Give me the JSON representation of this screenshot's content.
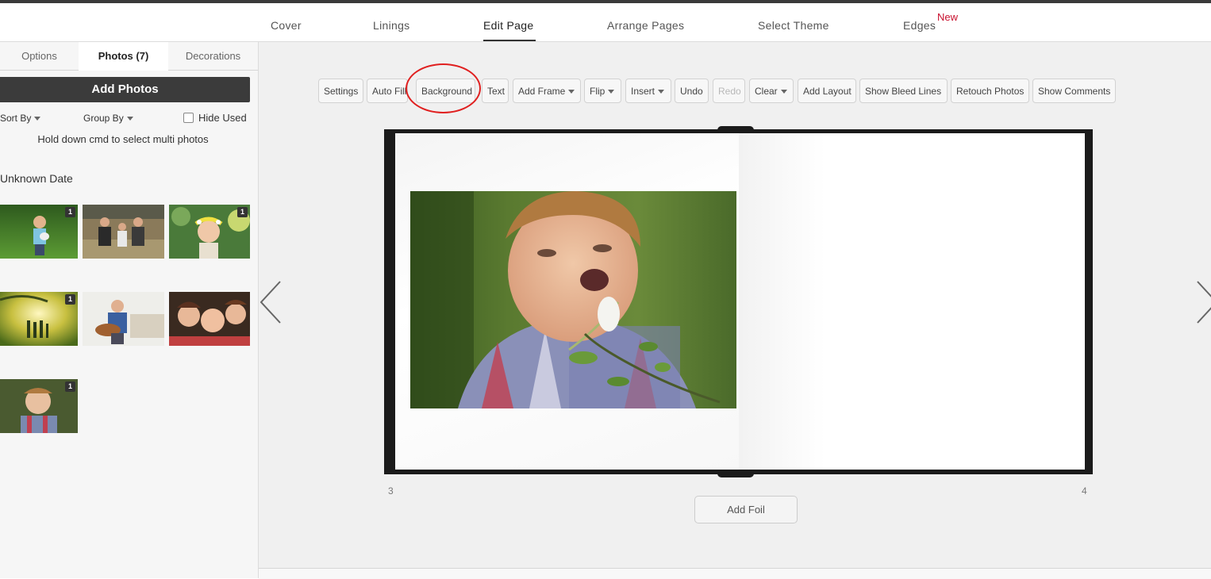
{
  "nav": {
    "items": [
      "Cover",
      "Linings",
      "Edit Page",
      "Arrange Pages",
      "Select Theme",
      "Edges"
    ],
    "active": "Edit Page",
    "badge": "New"
  },
  "sidebar": {
    "tabs": [
      "Options",
      "Photos (7)",
      "Decorations"
    ],
    "add_photos": "Add Photos",
    "sort_by": "Sort By",
    "group_by": "Group By",
    "hide_used": "Hide Used",
    "hint": "Hold down cmd to select multi photos",
    "date_header": "Unknown Date",
    "photo_badges": [
      "1",
      "1",
      "1",
      "1"
    ]
  },
  "toolbar": {
    "settings": "Settings",
    "auto_fill": "Auto Fill",
    "background": "Background",
    "text": "Text",
    "add_frame": "Add Frame",
    "flip": "Flip",
    "insert": "Insert",
    "undo": "Undo",
    "redo": "Redo",
    "clear": "Clear",
    "add_layout": "Add Layout",
    "show_bleed_lines": "Show Bleed Lines",
    "retouch_photos": "Retouch Photos",
    "show_comments": "Show Comments"
  },
  "book": {
    "left_page_number": "3",
    "right_page_number": "4",
    "add_foil": "Add Foil"
  },
  "colors": {
    "accent_red": "#e02020",
    "badge_red": "#c8102e",
    "dark_button": "#3b3b3b"
  }
}
